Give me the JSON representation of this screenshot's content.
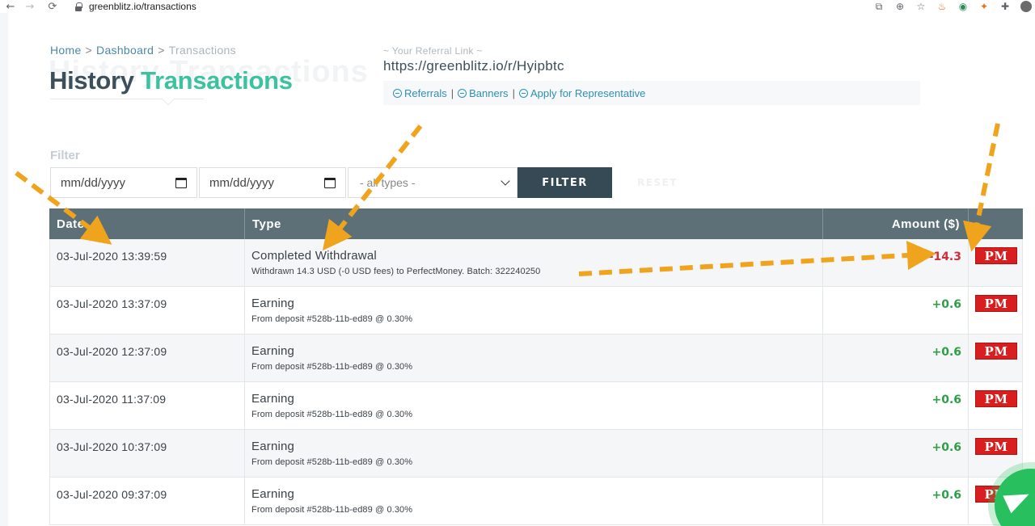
{
  "browser": {
    "back_icon": "arrow-left-icon",
    "forward_icon": "arrow-right-icon",
    "reload_icon": "reload-icon",
    "url": "greenblitz.io/transactions"
  },
  "breadcrumb": {
    "home": "Home",
    "dashboard": "Dashboard",
    "current": "Transactions",
    "separator": ">"
  },
  "page": {
    "title_ghost": "History Transactions",
    "title_part1": "History",
    "title_part2": "Transactions"
  },
  "referral": {
    "label": "~ Your Referral Link ~",
    "url": "https://greenblitz.io/r/Hyipbtc",
    "links": [
      "Referrals",
      "Banners",
      "Apply for Representative"
    ]
  },
  "filter": {
    "label": "Filter",
    "date_from": "mm/dd/yyyy",
    "date_to": "mm/dd/yyyy",
    "type_selected": "- all types -",
    "filter_button": "FILTER",
    "reset_button": "RESET"
  },
  "table": {
    "headers": {
      "date": "Date",
      "type": "Type",
      "amount": "Amount ($)"
    },
    "rows": [
      {
        "date": "03-Jul-2020 13:39:59",
        "type": "Completed Withdrawal",
        "detail": "Withdrawn 14.3 USD (-0 USD fees) to PerfectMoney. Batch: 322240250",
        "amount": "-14.3",
        "processor": "PM"
      },
      {
        "date": "03-Jul-2020 13:37:09",
        "type": "Earning",
        "detail": "From deposit #528b-11b-ed89 @ 0.30%",
        "amount": "+0.6",
        "processor": "PM"
      },
      {
        "date": "03-Jul-2020 12:37:09",
        "type": "Earning",
        "detail": "From deposit #528b-11b-ed89 @ 0.30%",
        "amount": "+0.6",
        "processor": "PM"
      },
      {
        "date": "03-Jul-2020 11:37:09",
        "type": "Earning",
        "detail": "From deposit #528b-11b-ed89 @ 0.30%",
        "amount": "+0.6",
        "processor": "PM"
      },
      {
        "date": "03-Jul-2020 10:37:09",
        "type": "Earning",
        "detail": "From deposit #528b-11b-ed89 @ 0.30%",
        "amount": "+0.6",
        "processor": "PM"
      },
      {
        "date": "03-Jul-2020 09:37:09",
        "type": "Earning",
        "detail": "From deposit #528b-11b-ed89 @ 0.30%",
        "amount": "+0.6",
        "processor": "PM"
      }
    ]
  },
  "colors": {
    "title_dark": "#3c4f5a",
    "title_green": "#3cc2a0",
    "table_header": "#5e7077",
    "filter_button": "#354a54",
    "amount_negative": "#d12c3c",
    "amount_positive": "#2e9e46",
    "pm_badge": "#d81e1e",
    "annotation_arrow": "#f0a41e",
    "telegram_button": "#28c05f"
  }
}
